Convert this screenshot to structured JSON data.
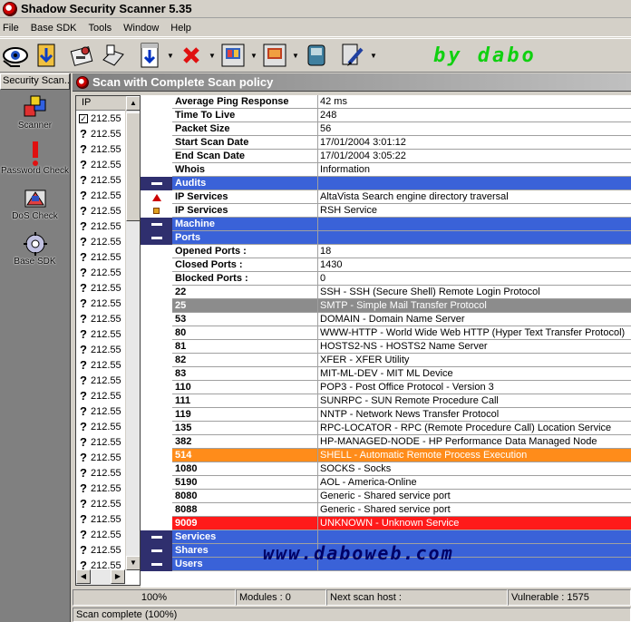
{
  "window": {
    "title": "Shadow Security Scanner 5.35"
  },
  "menu": [
    "File",
    "Base SDK",
    "Tools",
    "Window",
    "Help"
  ],
  "toolbar": {
    "buttons": [
      {
        "name": "scanner-eye-icon"
      },
      {
        "name": "download-icon"
      },
      {
        "name": "key-card-icon"
      },
      {
        "name": "scanner-device-icon"
      },
      {
        "name": "save-arrow-icon"
      },
      {
        "name": "red-x-icon"
      },
      {
        "name": "report-grid-icon"
      },
      {
        "name": "report-colored-icon"
      },
      {
        "name": "disk-icon"
      },
      {
        "name": "tool-pen-icon"
      }
    ],
    "brand": "by dabo",
    "brand_color": "#10d010"
  },
  "left_pane": {
    "header": "Security Scan...",
    "items": [
      {
        "label": "Scanner",
        "icon": "scanner-cubes-icon"
      },
      {
        "label": "Password Check",
        "icon": "password-alert-icon"
      },
      {
        "label": "DoS Check",
        "icon": "dos-shield-icon"
      },
      {
        "label": "Base SDK",
        "icon": "sdk-gear-icon"
      }
    ]
  },
  "child_window": {
    "title": "Scan with Complete Scan policy"
  },
  "ip_list": {
    "header": "IP",
    "rows": [
      "212.55",
      "212.55",
      "212.55",
      "212.55",
      "212.55",
      "212.55",
      "212.55",
      "212.55",
      "212.55",
      "212.55",
      "212.55",
      "212.55",
      "212.55",
      "212.55",
      "212.55",
      "212.55",
      "212.55",
      "212.55",
      "212.55",
      "212.55",
      "212.55",
      "212.55",
      "212.55",
      "212.55",
      "212.55",
      "212.55",
      "212.55",
      "212.55",
      "212.55",
      "212.55"
    ],
    "first_checked": true,
    "check_mark": "✓",
    "unknown_mark": "?"
  },
  "details": [
    {
      "key": "Average Ping Response",
      "value": "42 ms",
      "style": ""
    },
    {
      "key": "Time To Live",
      "value": "248",
      "style": ""
    },
    {
      "key": "Packet Size",
      "value": "56",
      "style": ""
    },
    {
      "key": "Start Scan Date",
      "value": "17/01/2004 3:01:12",
      "style": ""
    },
    {
      "key": "End Scan Date",
      "value": "17/01/2004 3:05:22",
      "style": ""
    },
    {
      "key": "Whois",
      "value": "Information",
      "style": ""
    },
    {
      "key": "Audits",
      "value": "",
      "style": "sec",
      "ind": "collapse"
    },
    {
      "key": "IP Services",
      "value": "AltaVista Search engine directory traversal",
      "style": "",
      "ind": "up"
    },
    {
      "key": "IP Services",
      "value": "RSH Service",
      "style": "",
      "ind": "sq"
    },
    {
      "key": "Machine",
      "value": "",
      "style": "sec",
      "ind": "collapse"
    },
    {
      "key": "Ports",
      "value": "",
      "style": "sec",
      "ind": "collapse"
    },
    {
      "key": "Opened Ports :",
      "value": "18",
      "style": ""
    },
    {
      "key": "Closed Ports :",
      "value": "1430",
      "style": ""
    },
    {
      "key": "Blocked Ports :",
      "value": "0",
      "style": ""
    },
    {
      "key": "22",
      "value": "SSH - SSH (Secure Shell) Remote Login Protocol",
      "style": ""
    },
    {
      "key": "25",
      "value": "SMTP - Simple Mail Transfer Protocol",
      "style": "gray"
    },
    {
      "key": "53",
      "value": "DOMAIN - Domain Name Server",
      "style": ""
    },
    {
      "key": "80",
      "value": "WWW-HTTP - World Wide Web HTTP (Hyper Text Transfer Protocol)",
      "style": ""
    },
    {
      "key": "81",
      "value": "HOSTS2-NS - HOSTS2 Name Server",
      "style": ""
    },
    {
      "key": "82",
      "value": "XFER - XFER Utility",
      "style": ""
    },
    {
      "key": "83",
      "value": "MIT-ML-DEV - MIT ML Device",
      "style": ""
    },
    {
      "key": "110",
      "value": "POP3 - Post Office Protocol - Version 3",
      "style": ""
    },
    {
      "key": "111",
      "value": "SUNRPC - SUN Remote Procedure Call",
      "style": ""
    },
    {
      "key": "119",
      "value": "NNTP - Network News Transfer Protocol",
      "style": ""
    },
    {
      "key": "135",
      "value": "RPC-LOCATOR - RPC (Remote Procedure Call) Location Service",
      "style": ""
    },
    {
      "key": "382",
      "value": "HP-MANAGED-NODE - HP Performance Data Managed Node",
      "style": ""
    },
    {
      "key": "514",
      "value": "SHELL - Automatic Remote Process Execution",
      "style": "orange"
    },
    {
      "key": "1080",
      "value": "SOCKS - Socks",
      "style": ""
    },
    {
      "key": "5190",
      "value": "AOL - America-Online",
      "style": ""
    },
    {
      "key": "8080",
      "value": "Generic - Shared service port",
      "style": ""
    },
    {
      "key": "8088",
      "value": "Generic - Shared service port",
      "style": ""
    },
    {
      "key": "9009",
      "value": "UNKNOWN - Unknown Service",
      "style": "red"
    },
    {
      "key": "Services",
      "value": "",
      "style": "sec",
      "ind": "collapse"
    },
    {
      "key": "Shares",
      "value": "",
      "style": "sec",
      "ind": "collapse"
    },
    {
      "key": "Users",
      "value": "",
      "style": "sec",
      "ind": "collapse"
    }
  ],
  "watermark": "www.daboweb.com",
  "status": {
    "progress": "100%",
    "modules": "Modules : 0",
    "next_scan": "Next scan host :",
    "vulnerable": "Vulnerable : 1575",
    "complete": "Scan complete (100%)"
  }
}
